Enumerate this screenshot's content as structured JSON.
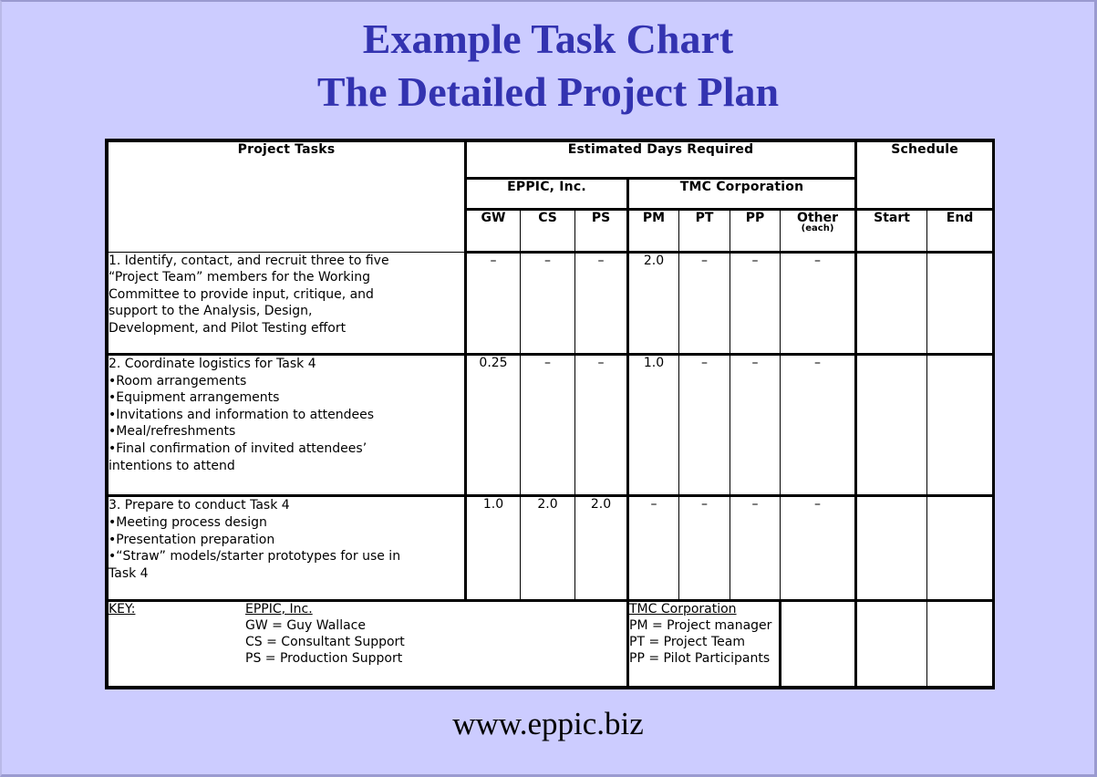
{
  "theme": {
    "background": "#ccccff",
    "title_color": "#3333b0",
    "table_border": "#000000",
    "cell_background": "#ffffff"
  },
  "title": {
    "line1": "Example Task Chart",
    "line2": "The Detailed Project Plan"
  },
  "footer": {
    "url": "www.eppic.biz"
  },
  "table": {
    "headers": {
      "project_tasks": "Project Tasks",
      "estimated_days_required": "Estimated Days Required",
      "schedule": "Schedule",
      "eppic": "EPPIC, Inc.",
      "tmc": "TMC Corporation",
      "columns": {
        "gw": "GW",
        "cs": "CS",
        "ps": "PS",
        "pm": "PM",
        "pt": "PT",
        "pp": "PP",
        "other": "Other",
        "other_sub": "(each)",
        "start": "Start",
        "end": "End"
      }
    },
    "rows": [
      {
        "task_lines": [
          "1. Identify, contact, and recruit three to five",
          "“Project Team” members for the Working",
          "Committee to provide input, critique, and",
          "support to the Analysis, Design,",
          "Development, and Pilot Testing effort"
        ],
        "gw": "–",
        "cs": "–",
        "ps": "–",
        "pm": "2.0",
        "pt": "–",
        "pp": "–",
        "other": "–",
        "start": "",
        "end": ""
      },
      {
        "task_lines": [
          "2. Coordinate logistics for Task 4",
          "•Room arrangements",
          "•Equipment arrangements",
          "•Invitations and information to attendees",
          "•Meal/refreshments",
          "•Final confirmation of invited attendees’",
          "intentions to attend"
        ],
        "gw": "0.25",
        "cs": "–",
        "ps": "–",
        "pm": "1.0",
        "pt": "–",
        "pp": "–",
        "other": "–",
        "start": "",
        "end": ""
      },
      {
        "task_lines": [
          "3. Prepare to conduct Task 4",
          "•Meeting process design",
          "•Presentation preparation",
          "•“Straw” models/starter prototypes for use in",
          "Task 4"
        ],
        "gw": "1.0",
        "cs": "2.0",
        "ps": "2.0",
        "pm": "–",
        "pt": "–",
        "pp": "–",
        "other": "–",
        "start": "",
        "end": ""
      }
    ],
    "key": {
      "label": "KEY:",
      "eppic_title": "EPPIC, Inc.",
      "eppic_lines": [
        "GW = Guy Wallace",
        "CS = Consultant Support",
        "PS = Production Support"
      ],
      "tmc_title": "TMC Corporation",
      "tmc_lines": [
        "PM = Project manager",
        "PT = Project Team",
        "PP = Pilot Participants"
      ],
      "other": "",
      "start": "",
      "end": ""
    }
  }
}
